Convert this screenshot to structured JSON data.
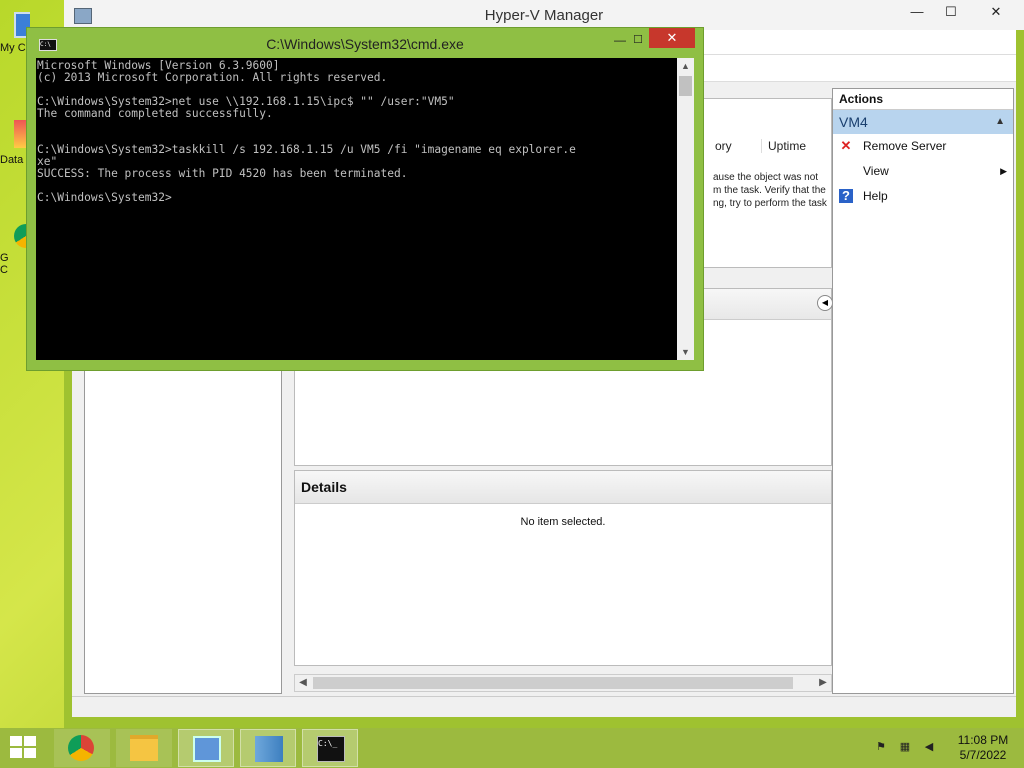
{
  "desktop": {
    "icons": [
      {
        "label": "My Co"
      },
      {
        "label": "Data"
      },
      {
        "label": "G\nC"
      }
    ]
  },
  "hyperv": {
    "title": "Hyper-V Manager",
    "controls": {
      "minimize": "—",
      "maximize": "☐",
      "close": "✕"
    },
    "vm_columns": {
      "memory": "ory",
      "uptime": "Uptime"
    },
    "vm_message": "ause the object was not\nm the task. Verify that the\nng, try to perform the task",
    "details": {
      "title": "Details",
      "empty_text": "No item selected."
    },
    "actions": {
      "header": "Actions",
      "group": "VM4",
      "items": [
        {
          "label": "Remove Server",
          "icon": "remove-icon"
        },
        {
          "label": "View",
          "icon": "view-icon",
          "has_submenu": true
        },
        {
          "label": "Help",
          "icon": "help-icon"
        }
      ]
    }
  },
  "cmd": {
    "title": "C:\\Windows\\System32\\cmd.exe",
    "controls": {
      "minimize": "—",
      "maximize": "☐",
      "close": "✕"
    },
    "console_text": "Microsoft Windows [Version 6.3.9600]\n(c) 2013 Microsoft Corporation. All rights reserved.\n\nC:\\Windows\\System32>net use \\\\192.168.1.15\\ipc$ \"\" /user:\"VM5\"\nThe command completed successfully.\n\n\nC:\\Windows\\System32>taskkill /s 192.168.1.15 /u VM5 /fi \"imagename eq explorer.e\nxe\"\nSUCCESS: The process with PID 4520 has been terminated.\n\nC:\\Windows\\System32>"
  },
  "taskbar": {
    "buttons": [
      "chrome",
      "file-explorer",
      "control-panel",
      "hyper-v-manager",
      "command-prompt"
    ],
    "clock": {
      "time": "11:08 PM",
      "date": "5/7/2022"
    }
  },
  "colors": {
    "accent": "#9fc230",
    "close": "#c7372c",
    "selection": "#b8d4ee"
  }
}
